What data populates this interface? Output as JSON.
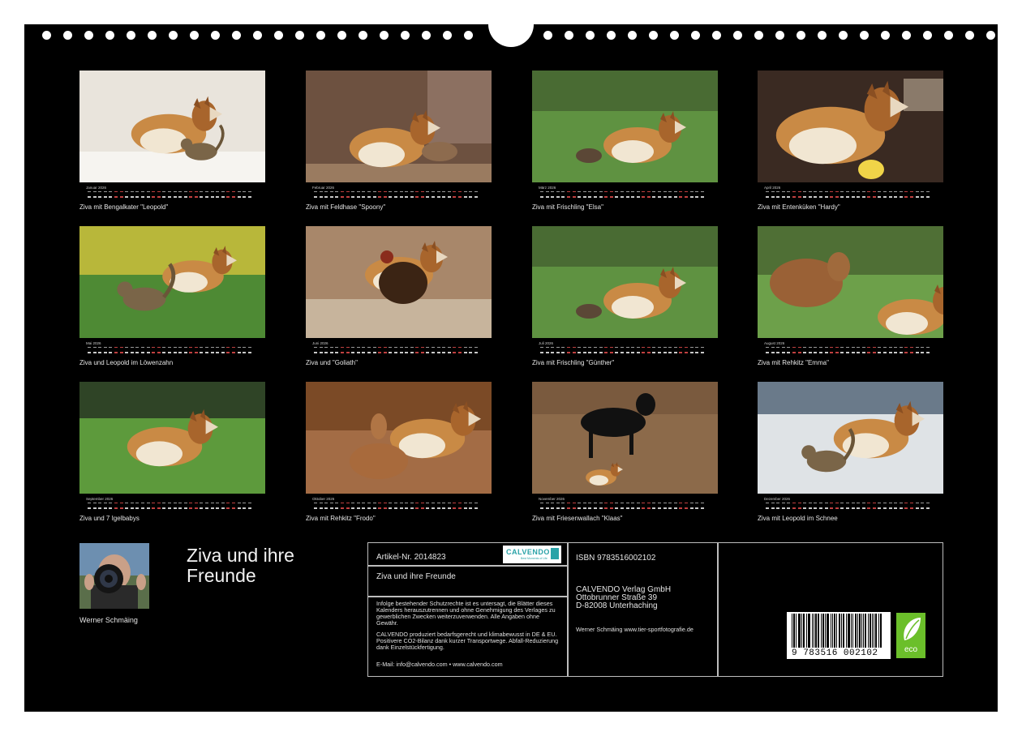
{
  "months": [
    {
      "name": "Januar 2026",
      "caption": "Ziva mit Bengalkater \"Leopold\"",
      "scene": "snow"
    },
    {
      "name": "Februar 2026",
      "caption": "Ziva mit Feldhase \"Spoony\"",
      "scene": "indoor"
    },
    {
      "name": "März 2026",
      "caption": "Ziva mit Frischling \"Elsa\"",
      "scene": "grass"
    },
    {
      "name": "April 2026",
      "caption": "Ziva mit Entenküken \"Hardy\"",
      "scene": "closeup"
    },
    {
      "name": "Mai 2026",
      "caption": "Ziva und Leopold im Löwenzahn",
      "scene": "flowers"
    },
    {
      "name": "Juni 2026",
      "caption": "Ziva und \"Goliath\"",
      "scene": "rooster"
    },
    {
      "name": "Juli 2026",
      "caption": "Ziva mit Frischling \"Günther\"",
      "scene": "grass"
    },
    {
      "name": "August 2026",
      "caption": "Ziva mit Rehkitz \"Emma\"",
      "scene": "deer"
    },
    {
      "name": "September 2026",
      "caption": "Ziva und 7 Igelbabys",
      "scene": "hedge"
    },
    {
      "name": "Oktober 2026",
      "caption": "Ziva mit Rehkitz \"Frodo\"",
      "scene": "sofa"
    },
    {
      "name": "November 2026",
      "caption": "Ziva mit Friesenwallach \"Klaas\"",
      "scene": "horse"
    },
    {
      "name": "Dezember 2026",
      "caption": "Ziva mit Leopold im Schnee",
      "scene": "snowcat"
    }
  ],
  "author": {
    "name": "Werner Schmäing"
  },
  "title": {
    "line1": "Ziva und ihre",
    "line2": "Freunde"
  },
  "info": {
    "article": "Artikel-Nr. 2014823",
    "logo": "CALVENDO",
    "logo_sub": "Best Moments of Life",
    "title": "Ziva und ihre Freunde",
    "legal1": "Infolge bestehender Schutzrechte ist es untersagt, die Blätter dieses Kalenders herauszutrennen und ohne Genehmigung des Verlages zu gewerblichen Zwecken weiterzuverwenden. Alle Angaben ohne Gewähr.",
    "legal2": "CALVENDO produziert bedarfsgerecht und klimabewusst in DE & EU. Positivere CO2-Bilanz dank kurzer Transportwege. Abfall-Reduzierung dank Einzelstückfertigung.",
    "contact": "E-Mail: info@calvendo.com • www.calvendo.com",
    "isbn": "ISBN 9783516002102",
    "publisher1": "CALVENDO Verlag GmbH",
    "publisher2": "Ottobrunner Straße 39",
    "publisher3": "D-82008 Unterhaching",
    "photographer": "Werner Schmäing www.tier-sportfotografie.de",
    "barcode_digits": "9 783516 002102",
    "eco": "eco"
  },
  "colors": {
    "background": "#000000",
    "border": "#bdbdbd",
    "calvendo_teal": "#2aa3a8",
    "eco_green": "#6bbf2a"
  }
}
